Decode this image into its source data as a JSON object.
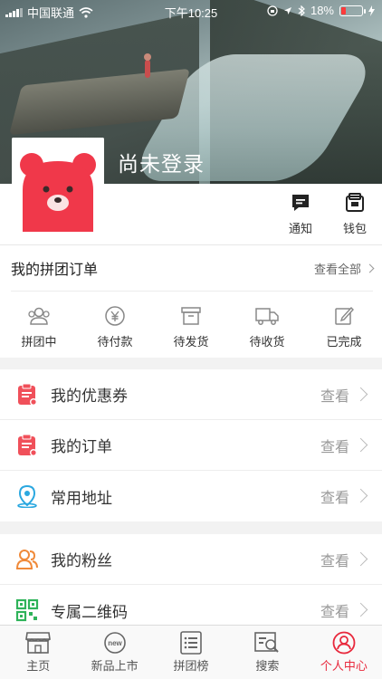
{
  "status_bar": {
    "carrier": "中国联通",
    "time": "下午10:25",
    "battery": "18%"
  },
  "profile": {
    "username": "尚未登录",
    "quick_actions": [
      {
        "label": "通知",
        "icon": "message-icon"
      },
      {
        "label": "钱包",
        "icon": "wallet-icon"
      }
    ]
  },
  "orders": {
    "title": "我的拼团订单",
    "view_all": "查看全部",
    "statuses": [
      {
        "label": "拼团中",
        "icon": "group-icon"
      },
      {
        "label": "待付款",
        "icon": "yuan-icon"
      },
      {
        "label": "待发货",
        "icon": "box-icon"
      },
      {
        "label": "待收货",
        "icon": "truck-icon"
      },
      {
        "label": "已完成",
        "icon": "edit-icon"
      }
    ]
  },
  "menu_group_1": [
    {
      "label": "我的优惠券",
      "action": "查看",
      "icon": "coupon-icon",
      "color": "#f0505a"
    },
    {
      "label": "我的订单",
      "action": "查看",
      "icon": "order-icon",
      "color": "#f0505a"
    },
    {
      "label": "常用地址",
      "action": "查看",
      "icon": "location-icon",
      "color": "#2ba8e0"
    }
  ],
  "menu_group_2": [
    {
      "label": "我的粉丝",
      "action": "查看",
      "icon": "fans-icon",
      "color": "#f08a3a"
    },
    {
      "label": "专属二维码",
      "action": "查看",
      "icon": "qrcode-icon",
      "color": "#2fb35a"
    }
  ],
  "tabbar": {
    "active": "个人中心",
    "tabs": [
      {
        "label": "主页",
        "icon": "shop-icon"
      },
      {
        "label": "新品上市",
        "icon": "new-icon"
      },
      {
        "label": "拼团榜",
        "icon": "list-icon"
      },
      {
        "label": "搜索",
        "icon": "search-icon"
      },
      {
        "label": "个人中心",
        "icon": "user-icon"
      }
    ]
  },
  "colors": {
    "accent": "#e8283c",
    "avatar_bear": "#f0384a"
  }
}
